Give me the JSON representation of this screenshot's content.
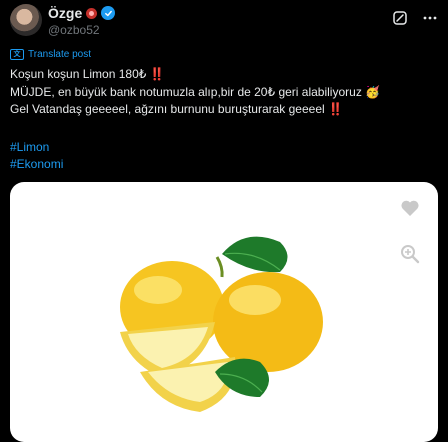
{
  "post": {
    "author_name": "Özge",
    "author_handle": "@ozbo52",
    "translate_label": "Translate post",
    "lines": [
      "Koşun koşun Limon 180₺ ‼️",
      "MÜJDE, en büyük bank notumuzla alıp,bir de 20₺ geri alabiliyoruz 🥳",
      "Gel Vatandaş geeeeel, ağzını burnunu buruşturarak geeeel ‼️"
    ],
    "hashtags": [
      "#Limon",
      "#Ekonomi"
    ]
  },
  "icons": {
    "verified": "verified-badge-icon",
    "flag": "red-flag-badge-icon",
    "grok": "grok-icon",
    "more": "more-icon",
    "translate": "translate-icon",
    "like": "heart-icon",
    "zoom": "zoom-icon"
  },
  "colors": {
    "background": "#000000",
    "text": "#e7e9ea",
    "secondary": "#71767b",
    "accent": "#1d9bf0"
  }
}
